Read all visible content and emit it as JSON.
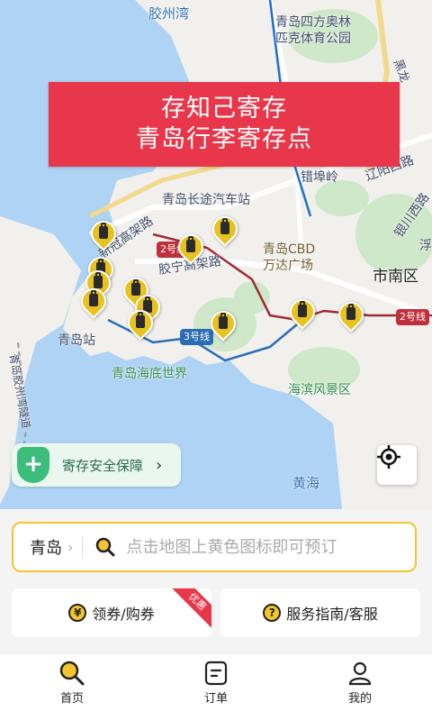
{
  "map": {
    "labels": {
      "jiaozhou_bay": "胶州湾",
      "qd_sports_park": "青岛四方奥林\n匹克体育公园",
      "cuobuling": "错埠岭",
      "liaoyang_road": "辽阳西路",
      "yinchuan_road": "银川西路",
      "fu": "浮",
      "changtu_station": "青岛长途汽车站",
      "cbd": "青岛CBD\n万达广场",
      "shinan": "市南区",
      "jiaoning_elevated": "胶宁高架路",
      "xinguan_elevated": "新冠高架路",
      "qd_station": "青岛站",
      "underwater_world": "青岛海底世界",
      "seaside": "海滨风景区",
      "yellow_sea": "黄海",
      "tunnel": "青岛胶州湾隧道",
      "line2a": "2号线",
      "line2b": "2号线",
      "line3": "3号线",
      "heilong": "黑龙"
    }
  },
  "banner": {
    "line1": "存知己寄存",
    "line2": "青岛行李寄存点"
  },
  "safety": {
    "label": "寄存安全保障"
  },
  "search": {
    "city": "青岛",
    "placeholder": "点击地图上黄色图标即可预订"
  },
  "cards": {
    "coupon": {
      "icon": "¥",
      "label": "领券/购券",
      "badge": "优惠"
    },
    "service": {
      "icon": "?",
      "label": "服务指南/客服"
    }
  },
  "tabs": [
    {
      "label": "首页",
      "icon": "search-icon"
    },
    {
      "label": "订单",
      "icon": "order-icon"
    },
    {
      "label": "我的",
      "icon": "user-icon"
    }
  ]
}
